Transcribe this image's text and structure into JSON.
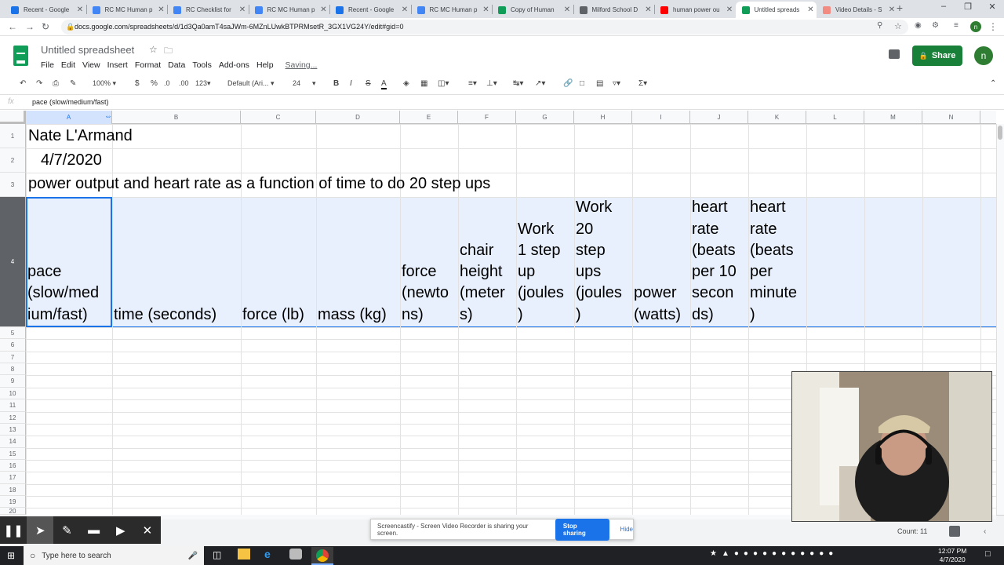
{
  "browser": {
    "tabs": [
      {
        "title": "Recent - Google",
        "color": "#1a73e8"
      },
      {
        "title": "RC MC Human p",
        "color": "#4285f4"
      },
      {
        "title": "RC Checklist for",
        "color": "#4285f4"
      },
      {
        "title": "RC MC Human p",
        "color": "#4285f4"
      },
      {
        "title": "Recent - Google",
        "color": "#1a73e8"
      },
      {
        "title": "RC MC Human p",
        "color": "#4285f4"
      },
      {
        "title": "Copy of Human",
        "color": "#0f9d58"
      },
      {
        "title": "Milford School D",
        "color": "#5f6368"
      },
      {
        "title": "human power ou",
        "color": "#ff0000"
      },
      {
        "title": "Untitled spreads",
        "color": "#0f9d58",
        "active": true
      },
      {
        "title": "Video Details - S",
        "color": "#f28b82"
      }
    ],
    "url": "docs.google.com/spreadsheets/d/1d3Qa0amT4saJWm-6MZnLUwkBTPRMsetR_3GX1VG24Y/edit#gid=0"
  },
  "sheets": {
    "title": "Untitled spreadsheet",
    "menu": [
      "File",
      "Edit",
      "View",
      "Insert",
      "Format",
      "Data",
      "Tools",
      "Add-ons",
      "Help"
    ],
    "saving": "Saving...",
    "share": "Share",
    "avatar": "n",
    "toolbar": {
      "zoom": "100%",
      "currency": "$",
      "percent": "%",
      "dec_dec": ".0",
      "dec_inc": ".00",
      "format": "123",
      "font": "Default (Ari...",
      "size": "24"
    },
    "formula": "pace (slow/medium/fast)",
    "columns": [
      "A",
      "B",
      "C",
      "D",
      "E",
      "F",
      "G",
      "H",
      "I",
      "J",
      "K",
      "L",
      "M",
      "N"
    ],
    "rows": [
      "1",
      "2",
      "3",
      "4",
      "5",
      "6",
      "7",
      "8",
      "9",
      "10",
      "11",
      "12",
      "13",
      "14",
      "15",
      "16",
      "17",
      "18",
      "19",
      "20"
    ],
    "cells": {
      "a1": "Nate L'Armand",
      "a2": "4/7/2020",
      "a3": "power output and heart rate as a function of time to do 20 step ups"
    },
    "header_row": {
      "a": [
        "pace",
        "(slow/med",
        "ium/fast)"
      ],
      "b": [
        "time (seconds)"
      ],
      "c": [
        "force (lb)"
      ],
      "d": [
        "mass (kg)"
      ],
      "e": [
        "force",
        "(newto",
        "ns)"
      ],
      "f": [
        "chair",
        "height",
        "(meter",
        "s)"
      ],
      "g": [
        "Work",
        "1 step",
        "up",
        "(joules",
        ")"
      ],
      "h": [
        "Work",
        "20",
        "step",
        "ups",
        "(joules",
        ")"
      ],
      "i": [
        "power",
        "(watts)"
      ],
      "j": [
        "heart",
        "rate",
        "(beats",
        "per 10",
        "secon",
        "ds)"
      ],
      "k": [
        "heart",
        "rate",
        "(beats",
        "per",
        "minute",
        ")"
      ]
    },
    "count": "Count: 11"
  },
  "screencastify": {
    "message": "Screencastify - Screen Video Recorder is sharing your screen.",
    "stop": "Stop sharing",
    "hide": "Hide"
  },
  "taskbar": {
    "search_placeholder": "Type here to search",
    "time": "12:07 PM",
    "date": "4/7/2020"
  }
}
